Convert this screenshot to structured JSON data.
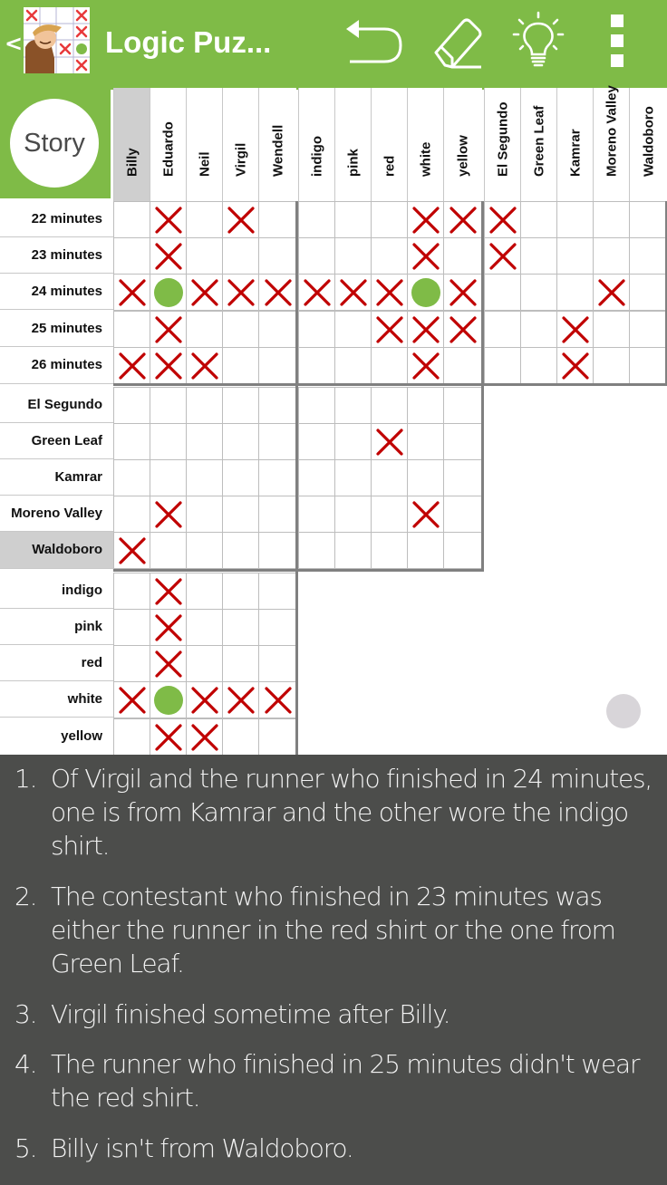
{
  "appbar": {
    "back_label": "<",
    "title": "Logic Puz...",
    "icons": [
      "undo-icon",
      "eraser-icon",
      "hint-lightbulb-icon",
      "overflow-menu-icon"
    ],
    "accent_color": "#7fbb47"
  },
  "story_button": {
    "label": "Story"
  },
  "columns": {
    "names": [
      "Billy",
      "Eduardo",
      "Neil",
      "Virgil",
      "Wendell"
    ],
    "shirts": [
      "indigo",
      "pink",
      "red",
      "white",
      "yellow"
    ],
    "towns": [
      "El Segundo",
      "Green Leaf",
      "Kamrar",
      "Moreno Valley",
      "Waldoboro"
    ],
    "selected": "Billy"
  },
  "rows": {
    "times": [
      "22 minutes",
      "23 minutes",
      "24 minutes",
      "25 minutes",
      "26 minutes"
    ],
    "towns": [
      "El Segundo",
      "Green Leaf",
      "Kamrar",
      "Moreno Valley",
      "Waldoboro"
    ],
    "shirts": [
      "indigo",
      "pink",
      "red",
      "white",
      "yellow"
    ],
    "selected": "Waldoboro"
  },
  "grid_marks": {
    "legend": {
      "X": "excluded",
      "O": "confirmed",
      ".": "empty"
    },
    "times_vs_names": [
      "   .X.X.",
      ".X...",
      "XOXXX",
      ".X...",
      "XXX.."
    ],
    "times_vs_shirts": [
      "...XX",
      "...X.",
      "XXXOX",
      "..XXX",
      "...X."
    ],
    "times_vs_towns": [
      "X....",
      "X....",
      "...X.",
      "..X..",
      "..X.."
    ],
    "towns_vs_names": [
      ".....",
      ".....",
      ".....",
      ".X...",
      "X...."
    ],
    "towns_vs_shirts": [
      ".....",
      "..X..",
      ".....",
      "...X.",
      "....."
    ],
    "shirts_vs_names": [
      ".X...",
      ".X...",
      ".X...",
      "XOXXX",
      ".XX.."
    ],
    "mark_colors": {
      "x": "#c00000",
      "dot": "#7fbb47"
    }
  },
  "clues": [
    {
      "num": "1.",
      "text": "Of Virgil and the runner who finished in 24 minutes, one is from Kamrar and the other wore the indigo shirt."
    },
    {
      "num": "2.",
      "text": "The contestant who finished in 23 minutes was either the runner in the red shirt or the one from Green Leaf."
    },
    {
      "num": "3.",
      "text": "Virgil finished sometime after Billy."
    },
    {
      "num": "4.",
      "text": "The runner who finished in 25 minutes didn't wear the red shirt."
    },
    {
      "num": "5.",
      "text": "Billy isn't from Waldoboro."
    }
  ]
}
